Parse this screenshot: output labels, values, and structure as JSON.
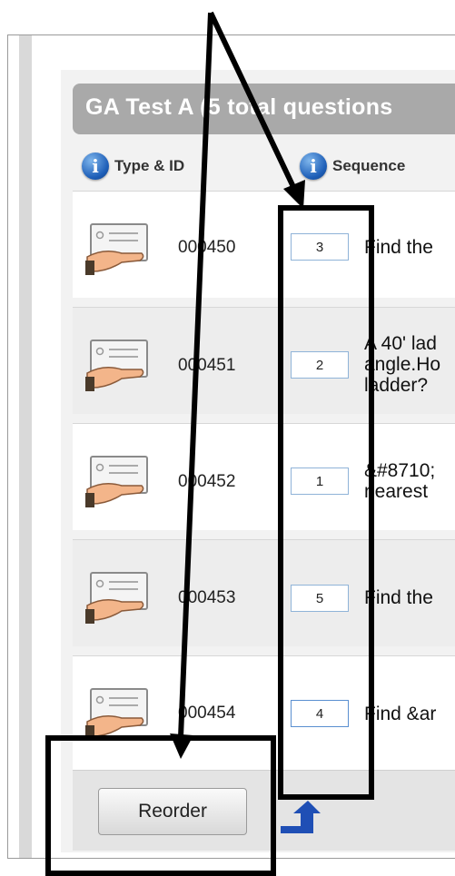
{
  "panel": {
    "title": "GA Test A (5 total questions"
  },
  "columns": {
    "type_id": "Type & ID",
    "sequence": "Sequence"
  },
  "rows": [
    {
      "id": "000450",
      "sequence": "3",
      "text": "Find the"
    },
    {
      "id": "000451",
      "sequence": "2",
      "text": "A 40' lad\nangle.Ho\nladder?"
    },
    {
      "id": "000452",
      "sequence": "1",
      "text": "&#8710;\nnearest"
    },
    {
      "id": "000453",
      "sequence": "5",
      "text": "Find the"
    },
    {
      "id": "000454",
      "sequence": "4",
      "text": "Find &ar"
    }
  ],
  "actions": {
    "reorder": "Reorder"
  },
  "icons": {
    "info": "info-icon",
    "question_type": "hand-holding-card-icon",
    "move_up": "up-arrow-icon"
  },
  "colors": {
    "title_bar": "#a9a9a9",
    "info_icon": "#1e5fb8",
    "input_border": "#8fb3d8",
    "annotation": "#000000"
  }
}
